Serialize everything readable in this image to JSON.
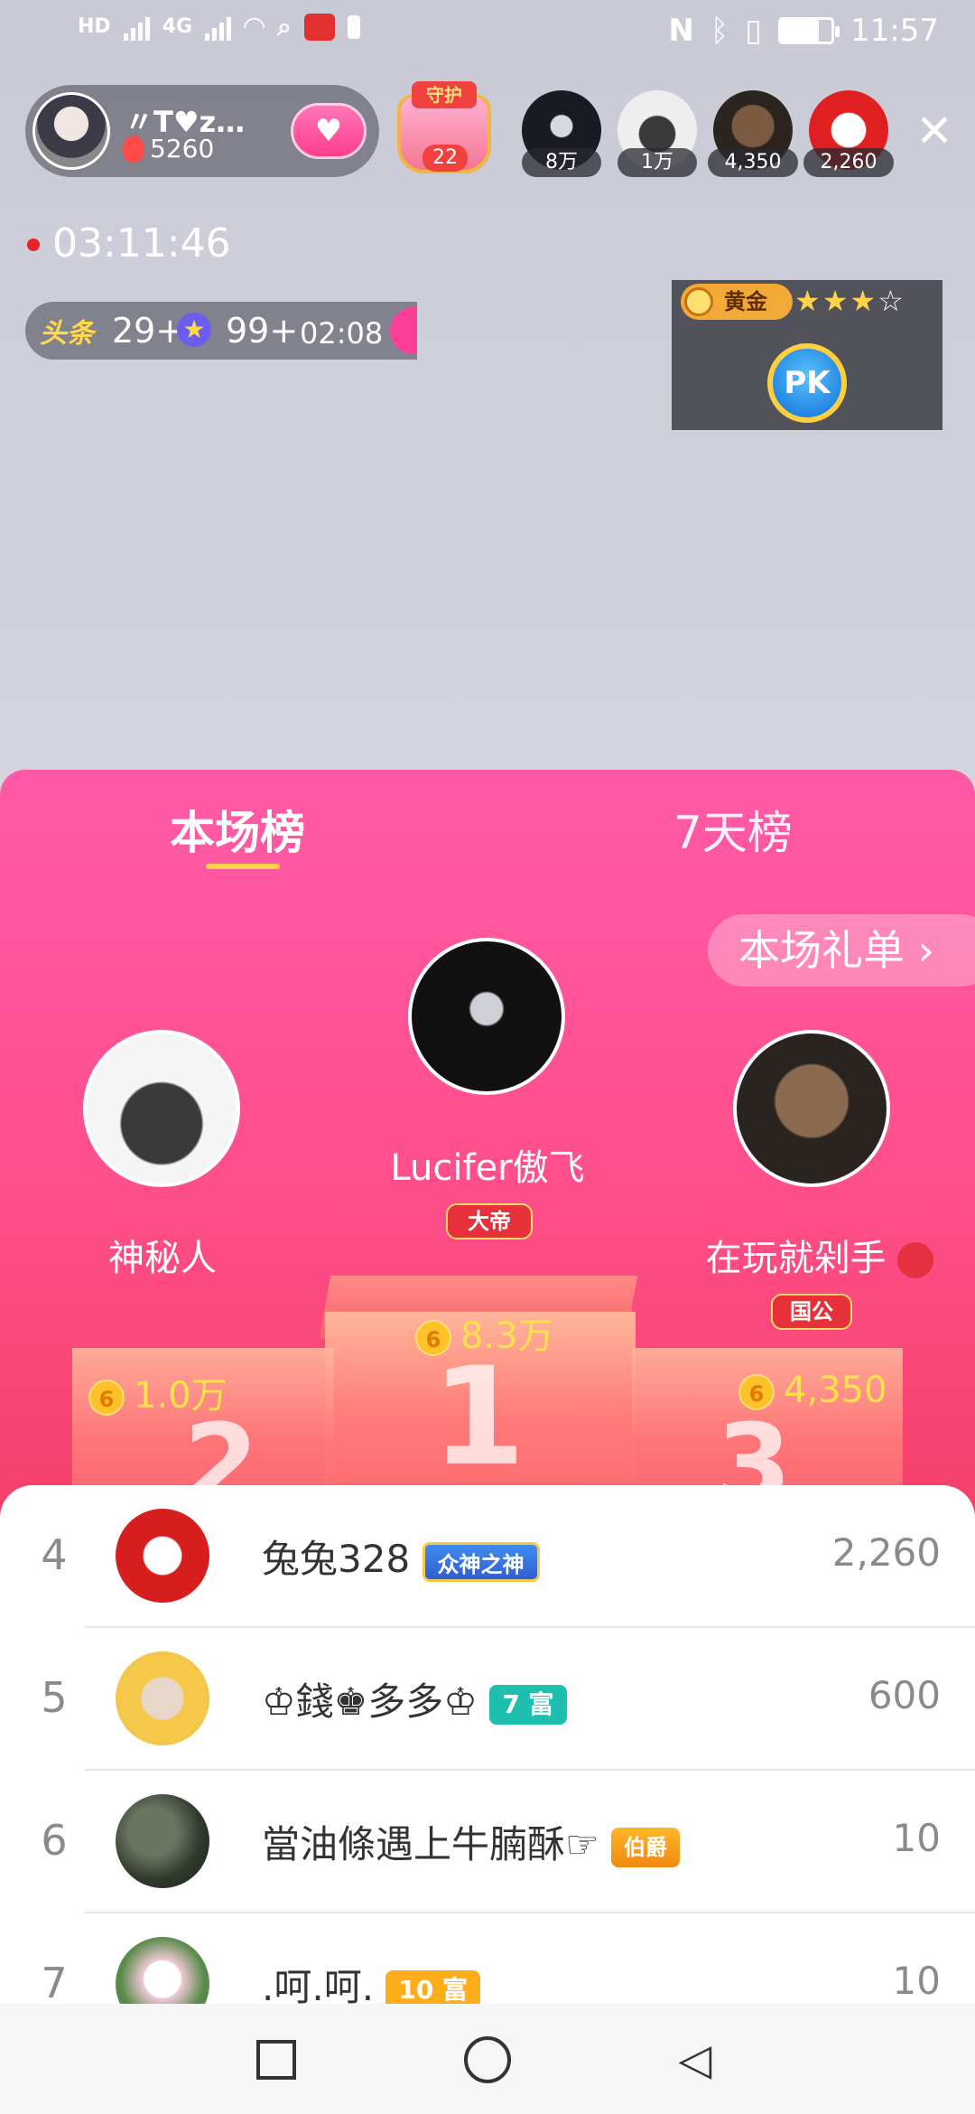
{
  "status_bar": {
    "network_tags": [
      "HD",
      "4G",
      "4G"
    ],
    "time": "11:57"
  },
  "host": {
    "name": "〃T♥z…",
    "count": "5260"
  },
  "guard": {
    "tag": "守护",
    "count": "22"
  },
  "viewers": [
    {
      "label": "8万"
    },
    {
      "label": "1万"
    },
    {
      "label": "4,350"
    },
    {
      "label": "2,260"
    }
  ],
  "live_timer": "03:11:46",
  "headline": {
    "tag": "头条",
    "count_a": "29+",
    "count_b": "99+",
    "time": "02:08"
  },
  "pk": {
    "rank": "黄金",
    "stars_filled": 3,
    "stars_total": 4,
    "button": "PK"
  },
  "panel": {
    "tabs": [
      {
        "label": "本场榜"
      },
      {
        "label": "7天榜"
      }
    ],
    "gift_list_link": "本场礼单 ›",
    "podium": [
      {
        "rank": 2,
        "name": "神秘人",
        "score": "1.0万"
      },
      {
        "rank": 1,
        "name": "Lucifer傲飞",
        "badge": "大帝",
        "score": "8.3万"
      },
      {
        "rank": 3,
        "name": "在玩就剁手",
        "badge": "国公",
        "score": "4,350"
      }
    ],
    "coin_symbol": "6"
  },
  "list": [
    {
      "rank": "4",
      "name": "兔兔328",
      "badge": "众神之神",
      "value": "2,260"
    },
    {
      "rank": "5",
      "name": "♔錢♚多多♔",
      "badge": "7 富",
      "value": "600"
    },
    {
      "rank": "6",
      "name": "當油條遇上牛腩酥☞",
      "badge": "伯爵",
      "value": "10"
    },
    {
      "rank": "7",
      "name": ".呵.呵.",
      "badge": "10 富",
      "value": "10"
    }
  ],
  "colors": {
    "accent": "#ff4f8c",
    "gold": "#ffe14a",
    "teal": "#1fbfae",
    "orange": "#ffae1a"
  }
}
